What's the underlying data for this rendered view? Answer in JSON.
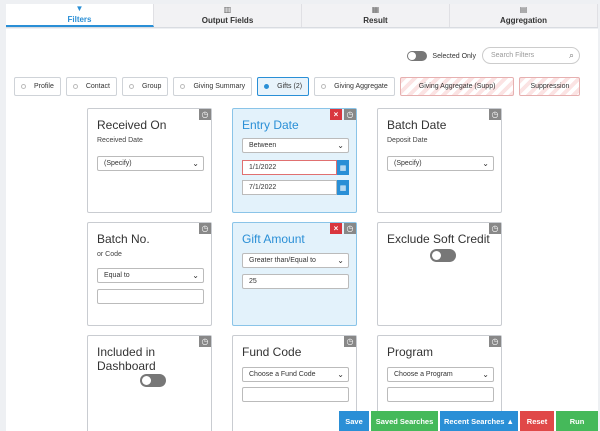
{
  "tabs": [
    {
      "label": "Filters",
      "icon": "filter-icon",
      "glyph": "▼",
      "active": true
    },
    {
      "label": "Output Fields",
      "icon": "map-icon",
      "glyph": "▥",
      "active": false
    },
    {
      "label": "Result",
      "icon": "table-icon",
      "glyph": "▦",
      "active": false
    },
    {
      "label": "Aggregation",
      "icon": "grid-icon",
      "glyph": "▤",
      "active": false
    }
  ],
  "toolbar": {
    "selected_only_label": "Selected Only",
    "selected_only_on": false,
    "search_placeholder": "Search Filters"
  },
  "categories": [
    {
      "label": "Profile"
    },
    {
      "label": "Contact"
    },
    {
      "label": "Group"
    },
    {
      "label": "Giving Summary"
    },
    {
      "label": "Gifts (2)",
      "active": true
    },
    {
      "label": "Giving Aggregate"
    },
    {
      "label": "Giving Aggregate (Supp)",
      "striped": true
    },
    {
      "label": "Suppression",
      "striped": true
    }
  ],
  "cards": {
    "received_on": {
      "title": "Received On",
      "sub": "Received Date",
      "select": "(Specify)"
    },
    "entry_date": {
      "title": "Entry Date",
      "select": "Between",
      "from": "1/1/2022",
      "to": "7/1/2022"
    },
    "batch_date": {
      "title": "Batch Date",
      "sub": "Deposit Date",
      "select": "(Specify)"
    },
    "batch_no": {
      "title": "Batch No.",
      "sub": "or Code",
      "select": "Equal to",
      "value": ""
    },
    "gift_amount": {
      "title": "Gift Amount",
      "select": "Greater than/Equal to",
      "value": "25"
    },
    "exclude_soft": {
      "title": "Exclude Soft Credit",
      "on": false
    },
    "included_dash": {
      "title": "Included in Dashboard",
      "on": false
    },
    "fund_code": {
      "title": "Fund Code",
      "select": "Choose a Fund Code",
      "value": ""
    },
    "program": {
      "title": "Program",
      "select": "Choose a Program",
      "value": ""
    }
  },
  "actions": {
    "save": "Save",
    "saved_searches": "Saved Searches",
    "recent_searches": "Recent Searches ▲",
    "reset": "Reset",
    "run": "Run"
  },
  "colors": {
    "accent": "#2a8fd6",
    "success": "#45b95a",
    "danger": "#e04848"
  }
}
